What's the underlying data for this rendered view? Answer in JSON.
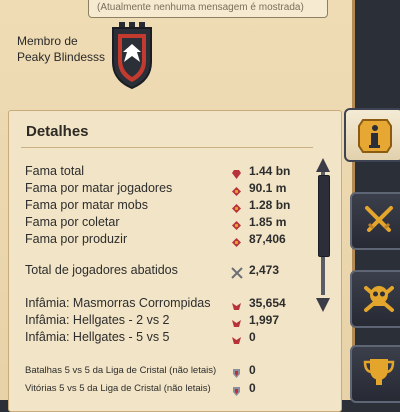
{
  "message_box": {
    "text": "(Atualmente nenhuma mensagem é mostrada)"
  },
  "guild": {
    "label_line1": "Membro de",
    "label_line2": "Peaky Blindesss",
    "emblem_icon": "eagle-shield-icon"
  },
  "details": {
    "title": "Detalhes",
    "rows": [
      {
        "label": "Fama total",
        "value": "1.44 bn",
        "icon": "fame-gem-icon"
      },
      {
        "label": "Fama por matar jogadores",
        "value": "90.1 m",
        "icon": "pvp-fame-icon"
      },
      {
        "label": "Fama por matar mobs",
        "value": "1.28 bn",
        "icon": "pve-fame-icon"
      },
      {
        "label": "Fama por coletar",
        "value": "1.85 m",
        "icon": "gathering-fame-icon"
      },
      {
        "label": "Fama por produzir",
        "value": "87,406",
        "icon": "crafting-fame-icon"
      },
      {
        "label": "Total de jogadores abatidos",
        "value": "2,473",
        "icon": "crossed-swords-icon"
      },
      {
        "label": "Infâmia: Masmorras Corrompidas",
        "value": "35,654",
        "icon": "infamy-icon"
      },
      {
        "label": "Infâmia: Hellgates - 2 vs 2",
        "value": "1,997",
        "icon": "infamy-icon"
      },
      {
        "label": "Infâmia: Hellgates - 5 vs 5",
        "value": "0",
        "icon": "infamy-icon"
      },
      {
        "label": "Batalhas 5 vs 5 da Liga de Cristal (não letais)",
        "value": "0",
        "icon": "crystal-league-icon"
      },
      {
        "label": "Vitórias 5 vs 5 da Liga de Cristal (não letais)",
        "value": "0",
        "icon": "crystal-league-icon"
      }
    ]
  },
  "tabs": [
    {
      "name": "info",
      "icon": "info-icon"
    },
    {
      "name": "pvp",
      "icon": "crossed-swords-icon"
    },
    {
      "name": "pve",
      "icon": "skull-crossbones-icon"
    },
    {
      "name": "achievements",
      "icon": "trophy-icon"
    }
  ],
  "colors": {
    "parchment": "#efdcb5",
    "panel": "#f2e4c6",
    "accent": "#e3a52c",
    "icon_red": "#b8323a",
    "tab_dark": "#2c2f3a"
  }
}
